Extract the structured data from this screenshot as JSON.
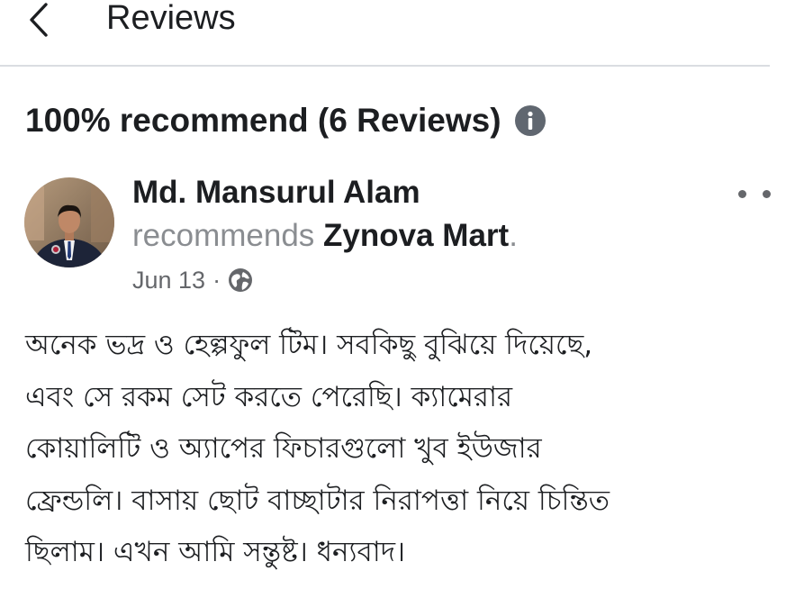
{
  "header": {
    "back_icon": "chevron-left-icon",
    "title": "Reviews"
  },
  "summary": {
    "text": "100% recommend (6 Reviews)",
    "info_icon": "info-icon"
  },
  "review": {
    "reviewer_name": "Md. Mansurul Alam",
    "action_text": "recommends",
    "page_name": "Zynova Mart",
    "action_suffix": ".",
    "date": "Jun 13",
    "separator": "·",
    "privacy_icon": "globe-icon",
    "more_icon": "more-options-icon",
    "lines": [
      "অনেক ভদ্র ও হেল্পফুল টিম। সবকিছু বুঝিয়ে দিয়েছে,",
      "এবং সে রকম সেট করতে পেরেছি। ক্যামেরার",
      "কোয়ালিটি ও অ্যাপের ফিচারগুলো খুব ইউজার",
      "ফ্রেন্ডলি। বাসায় ছোট বাচ্ছাটার নিরাপত্তা নিয়ে চিন্তিত",
      "ছিলাম। এখন আমি সন্তুষ্ট। ধন্যবাদ।"
    ]
  },
  "colors": {
    "text_primary": "#1c1e21",
    "text_secondary": "#8a8d91",
    "meta_gray": "#65676b",
    "divider": "#dadde1"
  }
}
